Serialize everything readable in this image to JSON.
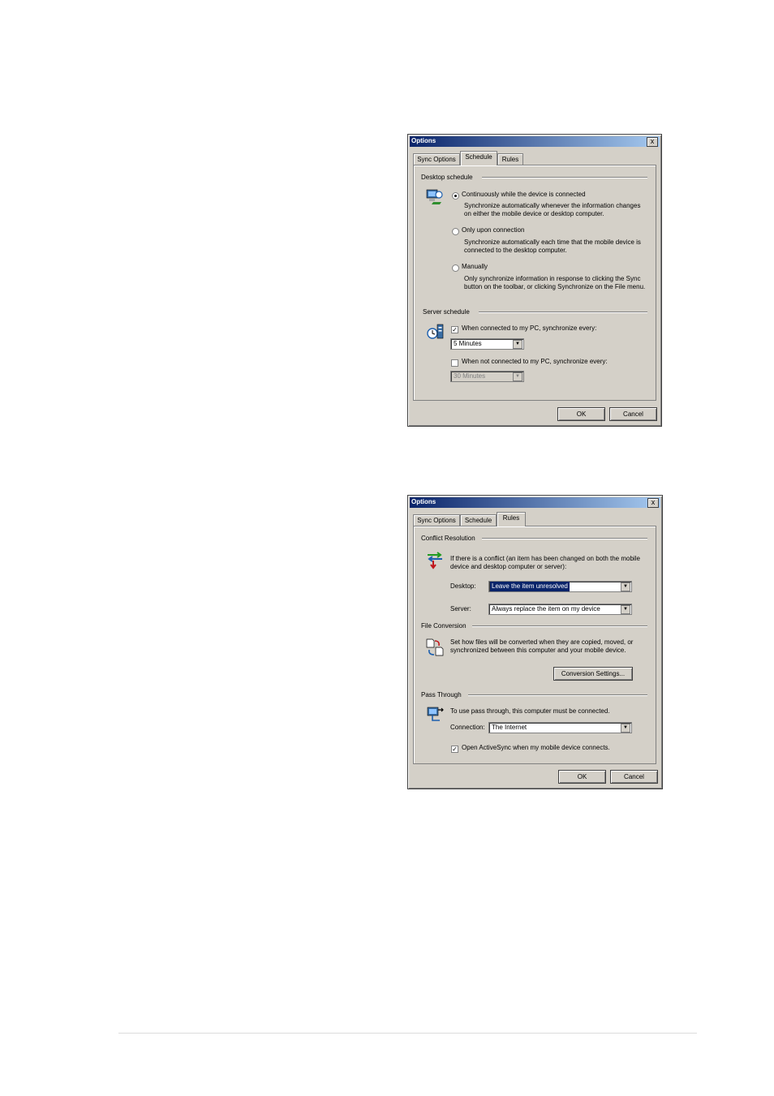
{
  "schedule_dialog": {
    "title": "Options",
    "close": "x",
    "tabs": [
      "Sync Options",
      "Schedule",
      "Rules"
    ],
    "desktop_schedule": {
      "label": "Desktop schedule",
      "opt1_label": "Continuously while the device is connected",
      "opt1_desc": "Synchronize automatically whenever the information changes on either the mobile device or desktop computer.",
      "opt2_label": "Only upon connection",
      "opt2_desc": "Synchronize automatically each time that the mobile device is connected to the desktop computer.",
      "opt3_label": "Manually",
      "opt3_desc": "Only synchronize information in response to clicking the Sync button on the toolbar, or clicking Synchronize on the File menu."
    },
    "server_schedule": {
      "label": "Server schedule",
      "connected_label": "When connected to my PC, synchronize every:",
      "connected_value": "5 Minutes",
      "not_connected_label": "When not connected to my PC, synchronize every:",
      "not_connected_value": "30 Minutes"
    },
    "ok": "OK",
    "cancel": "Cancel"
  },
  "rules_dialog": {
    "title": "Options",
    "close": "x",
    "tabs": [
      "Sync Options",
      "Schedule",
      "Rules"
    ],
    "conflict": {
      "label": "Conflict Resolution",
      "desc": "If there is a conflict (an item has been changed on both the mobile device and desktop computer or server):",
      "desktop_label": "Desktop:",
      "desktop_value": "Leave the item unresolved",
      "server_label": "Server:",
      "server_value": "Always replace the item on my device"
    },
    "file_conversion": {
      "label": "File Conversion",
      "desc": "Set how files will be converted when they are copied, moved, or synchronized between this computer and your mobile device.",
      "button": "Conversion Settings..."
    },
    "pass_through": {
      "label": "Pass Through",
      "desc": "To use pass through, this computer must be connected.",
      "connection_label": "Connection:",
      "connection_value": "The Internet",
      "open_activesync": "Open ActiveSync when my mobile device connects."
    },
    "ok": "OK",
    "cancel": "Cancel"
  }
}
